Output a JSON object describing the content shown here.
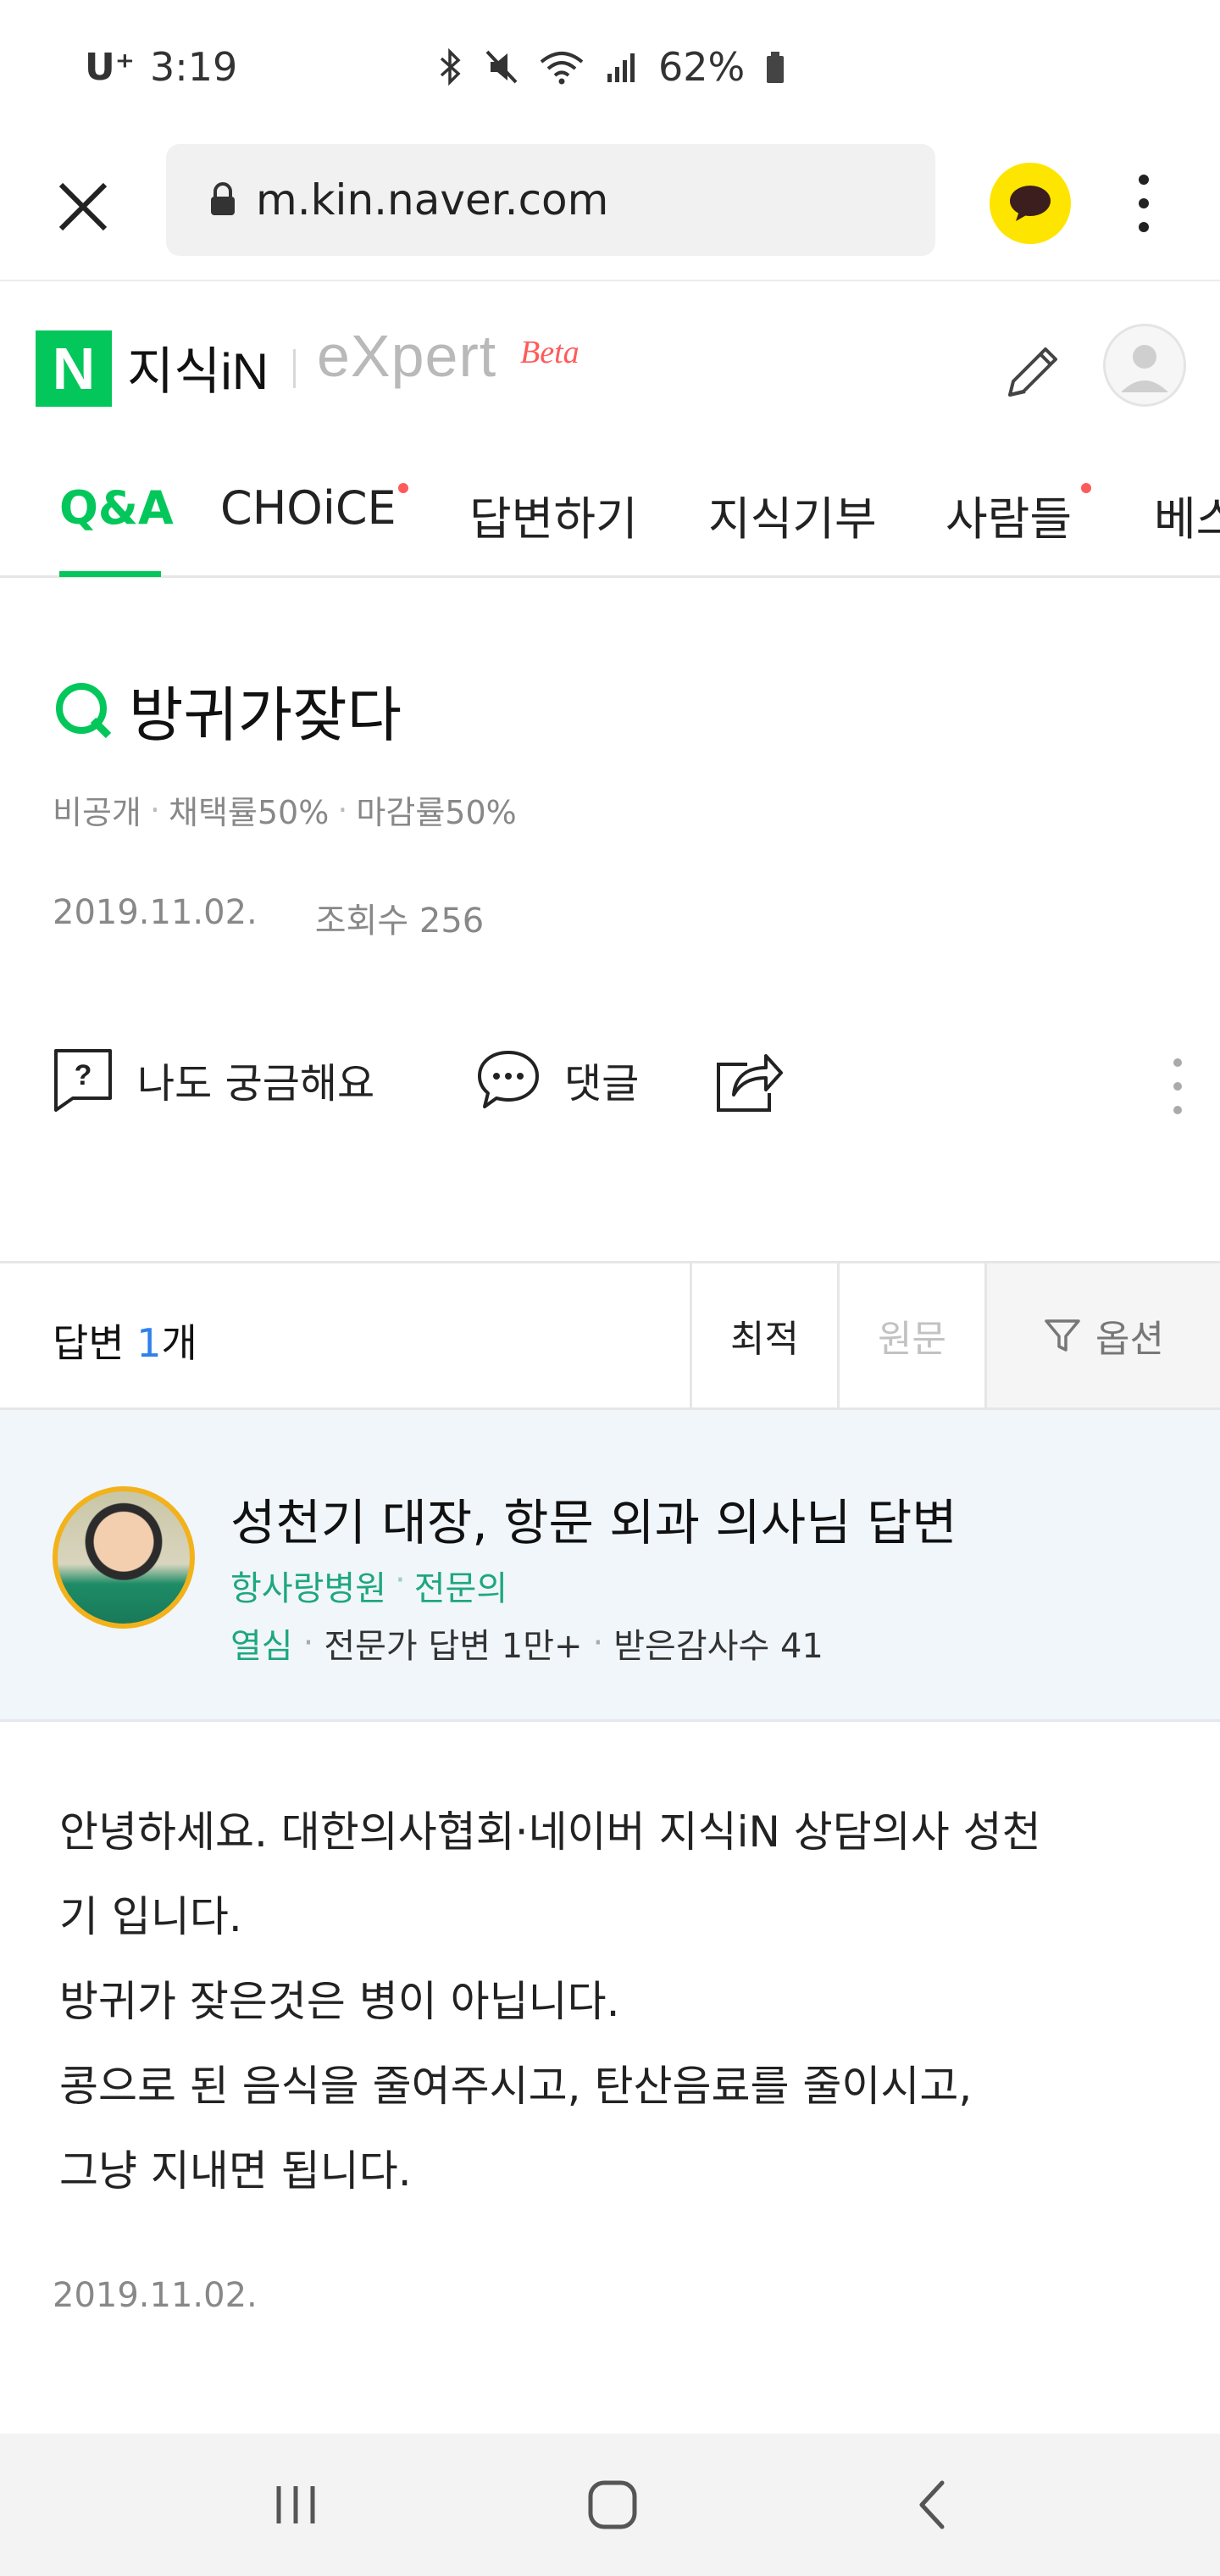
{
  "status_bar": {
    "carrier": "U⁺",
    "time": "3:19",
    "battery_text": "62%"
  },
  "browser": {
    "url": "m.kin.naver.com"
  },
  "header": {
    "logo_letter": "N",
    "service_name": "지식iN",
    "expert_word": "eXpert",
    "beta_word": "Beta"
  },
  "tabs": [
    {
      "label": "Q&A",
      "active": true
    },
    {
      "label": "CHOiCE",
      "active": false
    },
    {
      "label": "답변하기",
      "active": false
    },
    {
      "label": "지식기부",
      "active": false
    },
    {
      "label": "사람들",
      "active": false
    },
    {
      "label": "베스",
      "active": false
    }
  ],
  "question": {
    "title": "방귀가잦다",
    "meta_private": "비공개",
    "meta_adopt": "채택률50%",
    "meta_close": "마감률50%",
    "date": "2019.11.02.",
    "views": "조회수 256",
    "actions": {
      "curious": "나도 궁금해요",
      "comment": "댓글"
    }
  },
  "answers_bar": {
    "label_prefix": "답변 ",
    "count": "1",
    "label_suffix": "개",
    "sort_best": "최적",
    "sort_original": "원문",
    "options": "옵션"
  },
  "answerer": {
    "name": "성천기 대장, 항문 외과 의사님 답변",
    "hospital": "항사랑병원",
    "role": "전문의",
    "grade": "열심",
    "answers_stat": "전문가 답변 1만+",
    "thanks_stat": "받은감사수 41"
  },
  "answer": {
    "line1": "안녕하세요. 대한의사협회·네이버 지식iN 상담의사 성천",
    "line2": "기 입니다.",
    "line3": "방귀가 잦은것은 병이 아닙니다.",
    "line4": "콩으로 된 음식을 줄여주시고, 탄산음료를 줄이시고,",
    "line5": "그냥 지내면 됩니다.",
    "date": "2019.11.02."
  },
  "colors": {
    "naver_green": "#03c75a",
    "link_blue": "#2f80ed",
    "expert_green": "#1ea77d",
    "kakao_yellow": "#fee500",
    "new_dot_red": "#ff5a5a"
  },
  "icons": [
    "close-icon",
    "lock-icon",
    "kakaotalk-icon",
    "more-vertical-icon",
    "pencil-icon",
    "user-icon",
    "question-box-icon",
    "speech-bubble-icon",
    "share-icon",
    "filter-icon",
    "recent-apps-icon",
    "home-icon",
    "back-icon",
    "bluetooth-icon",
    "mute-icon",
    "wifi-icon",
    "signal-icon",
    "battery-icon"
  ]
}
